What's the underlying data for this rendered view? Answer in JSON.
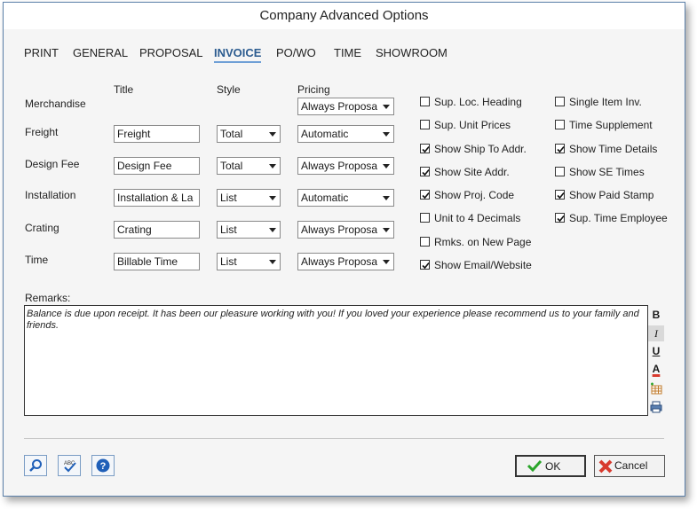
{
  "window": {
    "title": "Company Advanced Options"
  },
  "tabs": [
    {
      "label": "PRINT",
      "active": false
    },
    {
      "label": "GENERAL",
      "active": false
    },
    {
      "label": "PROPOSAL",
      "active": false
    },
    {
      "label": "INVOICE",
      "active": true
    },
    {
      "label": "PO/WO",
      "active": false
    },
    {
      "label": "TIME",
      "active": false
    },
    {
      "label": "SHOWROOM",
      "active": false
    }
  ],
  "columns": {
    "title": "Title",
    "style": "Style",
    "pricing": "Pricing"
  },
  "rows": [
    {
      "label": "Merchandise",
      "title": "",
      "style": "",
      "pricing": "Always Proposa"
    },
    {
      "label": "Freight",
      "title": "Freight",
      "style": "Total",
      "pricing": "Automatic"
    },
    {
      "label": "Design Fee",
      "title": "Design Fee",
      "style": "Total",
      "pricing": "Always Proposa"
    },
    {
      "label": "Installation",
      "title": "Installation & La",
      "style": "List",
      "pricing": "Automatic"
    },
    {
      "label": "Crating",
      "title": "Crating",
      "style": "List",
      "pricing": "Always Proposa"
    },
    {
      "label": "Time",
      "title": "Billable Time",
      "style": "List",
      "pricing": "Always Proposa"
    }
  ],
  "options_left": [
    {
      "label": "Sup. Loc. Heading",
      "checked": false
    },
    {
      "label": "Sup. Unit Prices",
      "checked": false
    },
    {
      "label": "Show Ship To Addr.",
      "checked": true
    },
    {
      "label": "Show Site Addr.",
      "checked": true
    },
    {
      "label": "Show Proj. Code",
      "checked": true
    },
    {
      "label": "Unit to 4 Decimals",
      "checked": false
    },
    {
      "label": "Rmks. on New Page",
      "checked": false
    },
    {
      "label": "Show Email/Website",
      "checked": true
    }
  ],
  "options_right": [
    {
      "label": "Single Item Inv.",
      "checked": false
    },
    {
      "label": "Time Supplement",
      "checked": false
    },
    {
      "label": "Show Time Details",
      "checked": true
    },
    {
      "label": "Show SE Times",
      "checked": false
    },
    {
      "label": "Show Paid Stamp",
      "checked": true
    },
    {
      "label": "Sup. Time Employee",
      "checked": true
    }
  ],
  "remarks": {
    "label": "Remarks:",
    "text": "Balance is due upon receipt.  It has been our pleasure working with you!  If you loved your experience please recommend us to your family and friends."
  },
  "format_toolbar": {
    "bold": "B",
    "italic": "I",
    "underline": "U",
    "color": "A"
  },
  "buttons": {
    "ok": "OK",
    "cancel": "Cancel"
  },
  "icons": [
    "search-icon",
    "spellcheck-icon",
    "help-icon",
    "ok-check-icon",
    "cancel-x-icon",
    "insert-table-icon",
    "print-icon"
  ],
  "colors": {
    "active_tab": "#2b5b8f",
    "ok_check": "#2aa52a",
    "cancel_x": "#d83a2e",
    "help_blue": "#1f5fb8"
  }
}
